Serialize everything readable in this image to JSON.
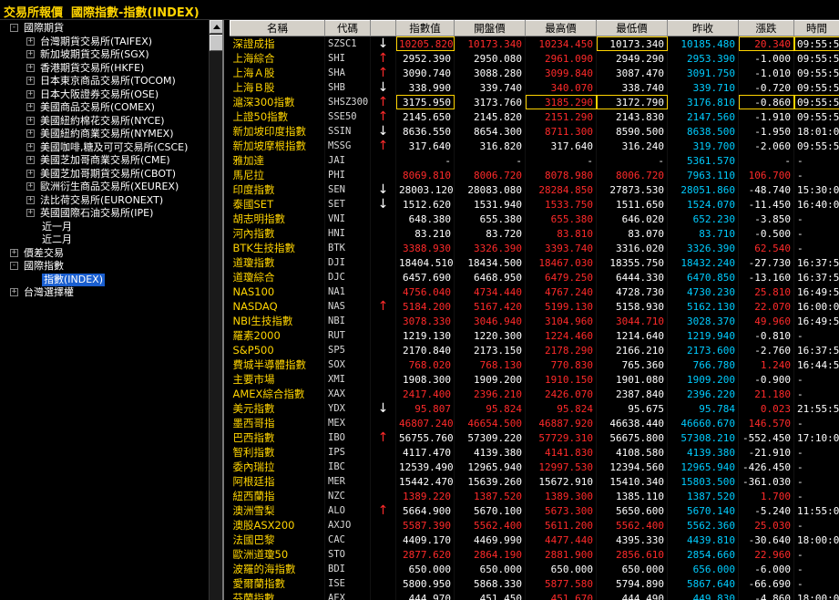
{
  "title": "交易所報價  國際指數-指數(INDEX)",
  "colors": {
    "up": "#ff2a2a",
    "flat": "#ffffff",
    "prev_close": "#00ccff",
    "name": "#ffd400",
    "selected": "#1a5fd0"
  },
  "tree": [
    {
      "label": "國際期貨",
      "level": 0,
      "expander": "−"
    },
    {
      "label": "台灣期貨交易所(TAIFEX)",
      "level": 1,
      "expander": "+"
    },
    {
      "label": "新加坡期貨交易所(SGX)",
      "level": 1,
      "expander": "+"
    },
    {
      "label": "香港期貨交易所(HKFE)",
      "level": 1,
      "expander": "+"
    },
    {
      "label": "日本東京商品交易所(TOCOM)",
      "level": 1,
      "expander": "+"
    },
    {
      "label": "日本大阪證券交易所(OSE)",
      "level": 1,
      "expander": "+"
    },
    {
      "label": "美國商品交易所(COMEX)",
      "level": 1,
      "expander": "+"
    },
    {
      "label": "美國紐約棉花交易所(NYCE)",
      "level": 1,
      "expander": "+"
    },
    {
      "label": "美國紐約商業交易所(NYMEX)",
      "level": 1,
      "expander": "+"
    },
    {
      "label": "美國咖啡,糖及可可交易所(CSCE)",
      "level": 1,
      "expander": "+"
    },
    {
      "label": "美國芝加哥商業交易所(CME)",
      "level": 1,
      "expander": "+"
    },
    {
      "label": "美國芝加哥期貨交易所(CBOT)",
      "level": 1,
      "expander": "+"
    },
    {
      "label": "歐洲衍生商品交易所(XEUREX)",
      "level": 1,
      "expander": "+"
    },
    {
      "label": "法比荷交易所(EURONEXT)",
      "level": 1,
      "expander": "+"
    },
    {
      "label": "英國國際石油交易所(IPE)",
      "level": 1,
      "expander": "+"
    },
    {
      "label": "近一月",
      "level": 2,
      "expander": ""
    },
    {
      "label": "近二月",
      "level": 2,
      "expander": ""
    },
    {
      "label": "價差交易",
      "level": 0,
      "expander": "+"
    },
    {
      "label": "國際指數",
      "level": 0,
      "expander": "−"
    },
    {
      "label": "指數(INDEX)",
      "level": 2,
      "expander": "",
      "selected": true
    },
    {
      "label": "台灣選擇權",
      "level": 0,
      "expander": "+"
    }
  ],
  "columns": [
    "名稱",
    "代碼",
    "",
    "指數值",
    "開盤價",
    "最高價",
    "最低價",
    "昨收",
    "漲跌",
    "時間"
  ],
  "rows": [
    {
      "name": "深證成指",
      "code": "SZSC1",
      "arrow": "↓",
      "arrow_dir": "down",
      "value": "10205.820",
      "open": "10173.340",
      "high": "10234.450",
      "low": "10173.340",
      "prev": "10185.480",
      "change": "20.340",
      "time": "09:55:54",
      "c": [
        "up",
        "up",
        "up",
        "down",
        "cyan",
        "up"
      ],
      "boxed": [
        true,
        false,
        false,
        true,
        false,
        true
      ],
      "time_boxed": true
    },
    {
      "name": "上海綜合",
      "code": "SHI",
      "arrow": "↑",
      "arrow_dir": "up",
      "value": "2952.390",
      "open": "2950.080",
      "high": "2961.090",
      "low": "2949.290",
      "prev": "2953.390",
      "change": "-1.000",
      "time": "09:55:51",
      "c": [
        "down",
        "down",
        "up",
        "down",
        "cyan",
        "down"
      ]
    },
    {
      "name": "上海Ａ股",
      "code": "SHA",
      "arrow": "↑",
      "arrow_dir": "up",
      "value": "3090.740",
      "open": "3088.280",
      "high": "3099.840",
      "low": "3087.470",
      "prev": "3091.750",
      "change": "-1.010",
      "time": "09:55:51",
      "c": [
        "down",
        "down",
        "up",
        "down",
        "cyan",
        "down"
      ]
    },
    {
      "name": "上海Ｂ股",
      "code": "SHB",
      "arrow": "↓",
      "arrow_dir": "down",
      "value": "338.990",
      "open": "339.740",
      "high": "340.070",
      "low": "338.740",
      "prev": "339.710",
      "change": "-0.720",
      "time": "09:55:51",
      "c": [
        "down",
        "down",
        "up",
        "down",
        "cyan",
        "down"
      ]
    },
    {
      "name": "滬深300指數",
      "code": "SHSZ300",
      "arrow": "↑",
      "arrow_dir": "up",
      "value": "3175.950",
      "open": "3173.760",
      "high": "3185.290",
      "low": "3172.790",
      "prev": "3176.810",
      "change": "-0.860",
      "time": "09:55:54",
      "c": [
        "down",
        "down",
        "up",
        "down",
        "cyan",
        "down"
      ],
      "boxed": [
        true,
        false,
        true,
        true,
        false,
        true
      ],
      "time_boxed": true
    },
    {
      "name": "上證50指數",
      "code": "SSE50",
      "arrow": "↑",
      "arrow_dir": "up",
      "value": "2145.650",
      "open": "2145.820",
      "high": "2151.290",
      "low": "2143.830",
      "prev": "2147.560",
      "change": "-1.910",
      "time": "09:55:51",
      "c": [
        "down",
        "down",
        "up",
        "down",
        "cyan",
        "down"
      ]
    },
    {
      "name": "新加坡印度指數",
      "code": "SSIN",
      "arrow": "↓",
      "arrow_dir": "down",
      "value": "8636.550",
      "open": "8654.300",
      "high": "8711.300",
      "low": "8590.500",
      "prev": "8638.500",
      "change": "-1.950",
      "time": "18:01:08",
      "c": [
        "down",
        "down",
        "up",
        "down",
        "cyan",
        "down"
      ]
    },
    {
      "name": "新加坡摩根指數",
      "code": "MSSG",
      "arrow": "↑",
      "arrow_dir": "up",
      "value": "317.640",
      "open": "316.820",
      "high": "317.640",
      "low": "316.240",
      "prev": "319.700",
      "change": "-2.060",
      "time": "09:55:52",
      "c": [
        "down",
        "down",
        "down",
        "down",
        "cyan",
        "down"
      ]
    },
    {
      "name": "雅加達",
      "code": "JAI",
      "arrow": "",
      "arrow_dir": "",
      "value": "-",
      "open": "-",
      "high": "-",
      "low": "-",
      "prev": "5361.570",
      "change": "-",
      "time": "-",
      "c": [
        "down",
        "down",
        "down",
        "down",
        "cyan",
        "down"
      ]
    },
    {
      "name": "馬尼拉",
      "code": "PHI",
      "arrow": "",
      "arrow_dir": "",
      "value": "8069.810",
      "open": "8006.720",
      "high": "8078.980",
      "low": "8006.720",
      "prev": "7963.110",
      "change": "106.700",
      "time": "-",
      "c": [
        "up",
        "up",
        "up",
        "up",
        "cyan",
        "up"
      ]
    },
    {
      "name": "印度指數",
      "code": "SEN",
      "arrow": "↓",
      "arrow_dir": "down",
      "value": "28003.120",
      "open": "28083.080",
      "high": "28284.850",
      "low": "27873.530",
      "prev": "28051.860",
      "change": "-48.740",
      "time": "15:30:00",
      "c": [
        "down",
        "down",
        "up",
        "down",
        "cyan",
        "down"
      ]
    },
    {
      "name": "泰國SET",
      "code": "SET",
      "arrow": "↓",
      "arrow_dir": "down",
      "value": "1512.620",
      "open": "1531.940",
      "high": "1533.750",
      "low": "1511.650",
      "prev": "1524.070",
      "change": "-11.450",
      "time": "16:40:00",
      "c": [
        "down",
        "down",
        "up",
        "down",
        "cyan",
        "down"
      ]
    },
    {
      "name": "胡志明指數",
      "code": "VNI",
      "arrow": "",
      "arrow_dir": "",
      "value": "648.380",
      "open": "655.380",
      "high": "655.380",
      "low": "646.020",
      "prev": "652.230",
      "change": "-3.850",
      "time": "-",
      "c": [
        "down",
        "down",
        "up",
        "down",
        "cyan",
        "down"
      ]
    },
    {
      "name": "河內指數",
      "code": "HNI",
      "arrow": "",
      "arrow_dir": "",
      "value": "83.210",
      "open": "83.720",
      "high": "83.810",
      "low": "83.070",
      "prev": "83.710",
      "change": "-0.500",
      "time": "-",
      "c": [
        "down",
        "down",
        "up",
        "down",
        "cyan",
        "down"
      ]
    },
    {
      "name": "BTK生技指數",
      "code": "BTK",
      "arrow": "",
      "arrow_dir": "",
      "value": "3388.930",
      "open": "3326.390",
      "high": "3393.740",
      "low": "3316.020",
      "prev": "3326.390",
      "change": "62.540",
      "time": "-",
      "c": [
        "up",
        "up",
        "up",
        "down",
        "cyan",
        "up"
      ]
    },
    {
      "name": "道瓊指數",
      "code": "DJI",
      "arrow": "",
      "arrow_dir": "",
      "value": "18404.510",
      "open": "18434.500",
      "high": "18467.030",
      "low": "18355.750",
      "prev": "18432.240",
      "change": "-27.730",
      "time": "16:37:59",
      "c": [
        "down",
        "down",
        "up",
        "down",
        "cyan",
        "down"
      ]
    },
    {
      "name": "道瓊綜合",
      "code": "DJC",
      "arrow": "",
      "arrow_dir": "",
      "value": "6457.690",
      "open": "6468.950",
      "high": "6479.250",
      "low": "6444.330",
      "prev": "6470.850",
      "change": "-13.160",
      "time": "16:37:59",
      "c": [
        "down",
        "down",
        "up",
        "down",
        "cyan",
        "down"
      ]
    },
    {
      "name": "NAS100",
      "code": "NA1",
      "arrow": "",
      "arrow_dir": "",
      "value": "4756.040",
      "open": "4734.440",
      "high": "4767.240",
      "low": "4728.730",
      "prev": "4730.230",
      "change": "25.810",
      "time": "16:49:58",
      "c": [
        "up",
        "up",
        "up",
        "down",
        "cyan",
        "up"
      ]
    },
    {
      "name": "NASDAQ",
      "code": "NAS",
      "arrow": "↑",
      "arrow_dir": "up",
      "value": "5184.200",
      "open": "5167.420",
      "high": "5199.130",
      "low": "5158.930",
      "prev": "5162.130",
      "change": "22.070",
      "time": "16:00:00",
      "c": [
        "up",
        "up",
        "up",
        "down",
        "cyan",
        "up"
      ]
    },
    {
      "name": "NBI生技指數",
      "code": "NBI",
      "arrow": "",
      "arrow_dir": "",
      "value": "3078.330",
      "open": "3046.940",
      "high": "3104.960",
      "low": "3044.710",
      "prev": "3028.370",
      "change": "49.960",
      "time": "16:49:58",
      "c": [
        "up",
        "up",
        "up",
        "up",
        "cyan",
        "up"
      ]
    },
    {
      "name": "羅素2000",
      "code": "RUT",
      "arrow": "",
      "arrow_dir": "",
      "value": "1219.130",
      "open": "1220.300",
      "high": "1224.460",
      "low": "1214.640",
      "prev": "1219.940",
      "change": "-0.810",
      "time": "-",
      "c": [
        "down",
        "down",
        "up",
        "down",
        "cyan",
        "down"
      ]
    },
    {
      "name": "S&P500",
      "code": "SP5",
      "arrow": "",
      "arrow_dir": "",
      "value": "2170.840",
      "open": "2173.150",
      "high": "2178.290",
      "low": "2166.210",
      "prev": "2173.600",
      "change": "-2.760",
      "time": "16:37:59",
      "c": [
        "down",
        "down",
        "up",
        "down",
        "cyan",
        "down"
      ]
    },
    {
      "name": "費城半導體指數",
      "code": "SOX",
      "arrow": "",
      "arrow_dir": "",
      "value": "768.020",
      "open": "768.130",
      "high": "770.830",
      "low": "765.360",
      "prev": "766.780",
      "change": "1.240",
      "time": "16:44:57",
      "c": [
        "up",
        "up",
        "up",
        "down",
        "cyan",
        "up"
      ]
    },
    {
      "name": "主要市場",
      "code": "XMI",
      "arrow": "",
      "arrow_dir": "",
      "value": "1908.300",
      "open": "1909.200",
      "high": "1910.150",
      "low": "1901.080",
      "prev": "1909.200",
      "change": "-0.900",
      "time": "-",
      "c": [
        "down",
        "down",
        "up",
        "down",
        "cyan",
        "down"
      ]
    },
    {
      "name": "AMEX綜合指數",
      "code": "XAX",
      "arrow": "",
      "arrow_dir": "",
      "value": "2417.400",
      "open": "2396.210",
      "high": "2426.070",
      "low": "2387.840",
      "prev": "2396.220",
      "change": "21.180",
      "time": "-",
      "c": [
        "up",
        "up",
        "up",
        "down",
        "cyan",
        "up"
      ]
    },
    {
      "name": "美元指數",
      "code": "YDX",
      "arrow": "↓",
      "arrow_dir": "down",
      "value": "95.807",
      "open": "95.824",
      "high": "95.824",
      "low": "95.675",
      "prev": "95.784",
      "change": "0.023",
      "time": "21:55:55",
      "c": [
        "up",
        "up",
        "up",
        "down",
        "cyan",
        "up"
      ]
    },
    {
      "name": "墨西哥指",
      "code": "MEX",
      "arrow": "",
      "arrow_dir": "",
      "value": "46807.240",
      "open": "46654.500",
      "high": "46887.920",
      "low": "46638.440",
      "prev": "46660.670",
      "change": "146.570",
      "time": "-",
      "c": [
        "up",
        "up",
        "up",
        "down",
        "cyan",
        "up"
      ]
    },
    {
      "name": "巴西指數",
      "code": "IBO",
      "arrow": "↑",
      "arrow_dir": "up",
      "value": "56755.760",
      "open": "57309.220",
      "high": "57729.310",
      "low": "56675.800",
      "prev": "57308.210",
      "change": "-552.450",
      "time": "17:10:00",
      "c": [
        "down",
        "down",
        "up",
        "down",
        "cyan",
        "down"
      ]
    },
    {
      "name": "智利指數",
      "code": "IPS",
      "arrow": "",
      "arrow_dir": "",
      "value": "4117.470",
      "open": "4139.380",
      "high": "4141.830",
      "low": "4108.580",
      "prev": "4139.380",
      "change": "-21.910",
      "time": "-",
      "c": [
        "down",
        "down",
        "up",
        "down",
        "cyan",
        "down"
      ]
    },
    {
      "name": "委內瑞拉",
      "code": "IBC",
      "arrow": "",
      "arrow_dir": "",
      "value": "12539.490",
      "open": "12965.940",
      "high": "12997.530",
      "low": "12394.560",
      "prev": "12965.940",
      "change": "-426.450",
      "time": "-",
      "c": [
        "down",
        "down",
        "up",
        "down",
        "cyan",
        "down"
      ]
    },
    {
      "name": "阿根廷指",
      "code": "MER",
      "arrow": "",
      "arrow_dir": "",
      "value": "15442.470",
      "open": "15639.260",
      "high": "15672.910",
      "low": "15410.340",
      "prev": "15803.500",
      "change": "-361.030",
      "time": "-",
      "c": [
        "down",
        "down",
        "down",
        "down",
        "cyan",
        "down"
      ]
    },
    {
      "name": "紐西蘭指",
      "code": "NZC",
      "arrow": "",
      "arrow_dir": "",
      "value": "1389.220",
      "open": "1387.520",
      "high": "1389.300",
      "low": "1385.110",
      "prev": "1387.520",
      "change": "1.700",
      "time": "-",
      "c": [
        "up",
        "up",
        "up",
        "down",
        "cyan",
        "up"
      ]
    },
    {
      "name": "澳洲雪梨",
      "code": "ALO",
      "arrow": "↑",
      "arrow_dir": "up",
      "value": "5664.900",
      "open": "5670.100",
      "high": "5673.300",
      "low": "5650.600",
      "prev": "5670.140",
      "change": "-5.240",
      "time": "11:55:00",
      "c": [
        "down",
        "down",
        "up",
        "down",
        "cyan",
        "down"
      ]
    },
    {
      "name": "澳股ASX200",
      "code": "AXJO",
      "arrow": "",
      "arrow_dir": "",
      "value": "5587.390",
      "open": "5562.400",
      "high": "5611.200",
      "low": "5562.400",
      "prev": "5562.360",
      "change": "25.030",
      "time": "-",
      "c": [
        "up",
        "up",
        "up",
        "up",
        "cyan",
        "up"
      ]
    },
    {
      "name": "法國巴黎",
      "code": "CAC",
      "arrow": "",
      "arrow_dir": "",
      "value": "4409.170",
      "open": "4469.990",
      "high": "4477.440",
      "low": "4395.330",
      "prev": "4439.810",
      "change": "-30.640",
      "time": "18:00:00",
      "c": [
        "down",
        "down",
        "up",
        "down",
        "cyan",
        "down"
      ]
    },
    {
      "name": "歐洲道瓊50",
      "code": "STO",
      "arrow": "",
      "arrow_dir": "",
      "value": "2877.620",
      "open": "2864.190",
      "high": "2881.900",
      "low": "2856.610",
      "prev": "2854.660",
      "change": "22.960",
      "time": "-",
      "c": [
        "up",
        "up",
        "up",
        "up",
        "cyan",
        "up"
      ]
    },
    {
      "name": "波羅的海指數",
      "code": "BDI",
      "arrow": "",
      "arrow_dir": "",
      "value": "650.000",
      "open": "650.000",
      "high": "650.000",
      "low": "650.000",
      "prev": "656.000",
      "change": "-6.000",
      "time": "-",
      "c": [
        "down",
        "down",
        "down",
        "down",
        "cyan",
        "down"
      ]
    },
    {
      "name": "愛爾蘭指數",
      "code": "ISE",
      "arrow": "",
      "arrow_dir": "",
      "value": "5800.950",
      "open": "5868.330",
      "high": "5877.580",
      "low": "5794.890",
      "prev": "5867.640",
      "change": "-66.690",
      "time": "-",
      "c": [
        "down",
        "down",
        "up",
        "down",
        "cyan",
        "down"
      ]
    },
    {
      "name": "芬蘭指數",
      "code": "AEX",
      "arrow": "",
      "arrow_dir": "",
      "value": "444.970",
      "open": "451.450",
      "high": "451.670",
      "low": "444.490",
      "prev": "449.830",
      "change": "-4.860",
      "time": "18:00:00",
      "c": [
        "down",
        "down",
        "up",
        "down",
        "cyan",
        "down"
      ]
    }
  ]
}
